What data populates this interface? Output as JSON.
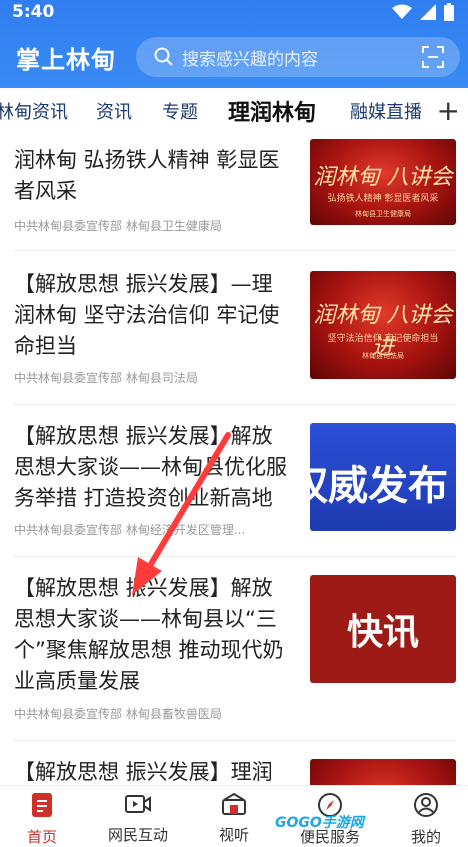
{
  "status": {
    "time": "5:40"
  },
  "header": {
    "title": "掌上林甸",
    "search_placeholder": "搜索感兴趣的内容"
  },
  "tabs": [
    {
      "label": "林甸资讯"
    },
    {
      "label": "资讯"
    },
    {
      "label": "专题"
    },
    {
      "label": "理润林甸",
      "active": true
    },
    {
      "label": "融媒直播"
    }
  ],
  "articles": [
    {
      "title": "润林甸 弘扬铁人精神 彰显医者风采",
      "source": "中共林甸县委宣传部 林甸县卫生健康局",
      "thumb": {
        "t1": "润林甸 八讲会",
        "t2": "弘扬铁人精神 彰显医者风采",
        "t3": "林甸县卫生健康局"
      }
    },
    {
      "title": "【解放思想 振兴发展】—理润林甸 坚守法治信仰 牢记使命担当",
      "source": "中共林甸县委宣传部 林甸县司法局",
      "thumb": {
        "t1": "润林甸 八讲会 进",
        "t2": "坚守法治信仰 牢记使命担当",
        "t3": "林甸县司法局"
      }
    },
    {
      "title": "【解放思想 振兴发展】解放思想大家谈——林甸县优化服务举措 打造投资创业新高地",
      "source": "中共林甸县委宣传部 林甸经济开发区管理...",
      "thumb": {
        "big": "权威发布"
      }
    },
    {
      "title": "【解放思想 振兴发展】解放思想大家谈——林甸县以“三个”聚焦解放思想 推动现代奶业高质量发展",
      "source": "中共林甸县委宣传部 林甸县畜牧兽医局",
      "thumb": {
        "big": "快讯"
      }
    },
    {
      "title": "【解放思想 振兴发展】理润",
      "source": "",
      "thumb": {}
    }
  ],
  "nav": [
    {
      "label": "首页",
      "icon": "home-icon",
      "active": true
    },
    {
      "label": "网民互动",
      "icon": "video-icon"
    },
    {
      "label": "视听",
      "icon": "tv-icon"
    },
    {
      "label": "便民服务",
      "icon": "compass-icon"
    },
    {
      "label": "我的",
      "icon": "user-icon"
    }
  ],
  "watermark": "GOGO手游网",
  "colors": {
    "header_blue": "#2f7df0",
    "accent_red": "#d0302a",
    "kuaixun_red": "#9e1a17"
  }
}
